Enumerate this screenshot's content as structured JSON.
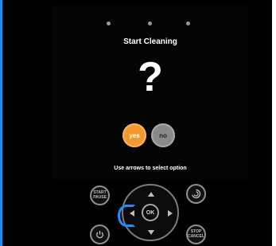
{
  "screen": {
    "title": "Start Cleaning",
    "prompt_symbol": "?",
    "options": {
      "yes": "yes",
      "no": "no",
      "selected": "yes"
    },
    "hint": "Use arrows to select option",
    "page_dots": 3
  },
  "remote": {
    "start_pause": "START\nPAUSE",
    "stop_cancel": "STOP\nCANCEL",
    "ok": "OK",
    "power_icon": "power-icon",
    "spot_icon": "spot-cleaning-icon"
  },
  "colors": {
    "accent_yes": "#f39a2e",
    "option_no": "#8a8a8a",
    "highlight": "#1d8fff",
    "frame": "#1f8ee6"
  }
}
